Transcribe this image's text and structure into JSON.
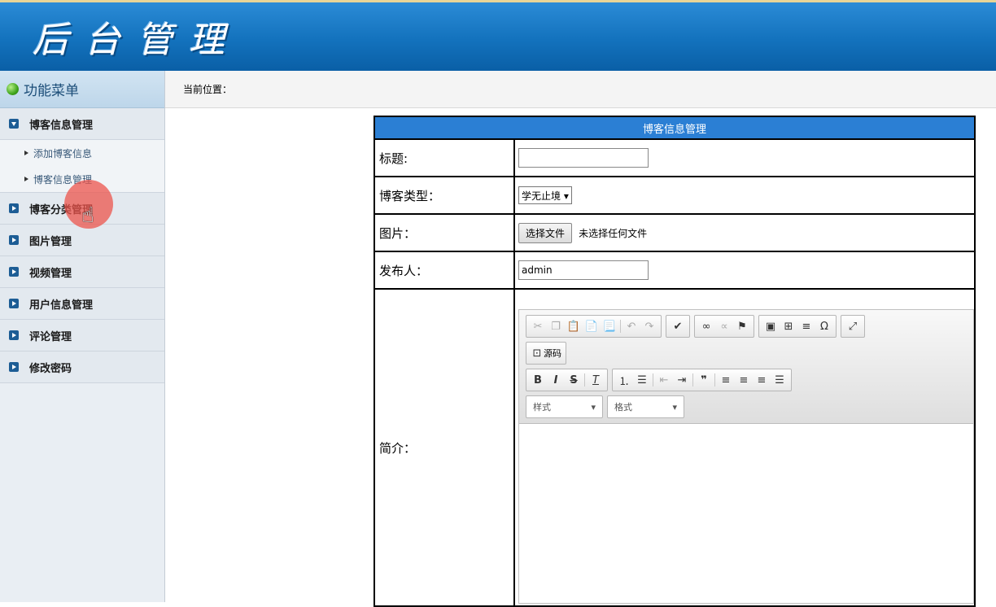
{
  "header": {
    "logo_text": "后台管理"
  },
  "sidebar": {
    "title": "功能菜单",
    "categories": [
      {
        "label": "博客信息管理",
        "open": true,
        "items": [
          "添加博客信息",
          "博客信息管理"
        ]
      },
      {
        "label": "博客分类管理"
      },
      {
        "label": "图片管理"
      },
      {
        "label": "视频管理"
      },
      {
        "label": "用户信息管理"
      },
      {
        "label": "评论管理"
      },
      {
        "label": "修改密码"
      }
    ]
  },
  "breadcrumb": {
    "label": "当前位置："
  },
  "form": {
    "title": "博客信息管理",
    "fields": {
      "title_label": "标题:",
      "title_value": "",
      "type_label": "博客类型：",
      "type_selected": "学无止境",
      "image_label": "图片：",
      "file_button": "选择文件",
      "file_status": "未选择任何文件",
      "publisher_label": "发布人：",
      "publisher_value": "admin",
      "intro_label": "简介："
    },
    "editor": {
      "source_label": "源码",
      "style_label": "样式",
      "format_label": "格式"
    }
  },
  "colors": {
    "header": "#1372bd",
    "table_title": "#2b7fd4",
    "cursor": "#ec544c"
  }
}
